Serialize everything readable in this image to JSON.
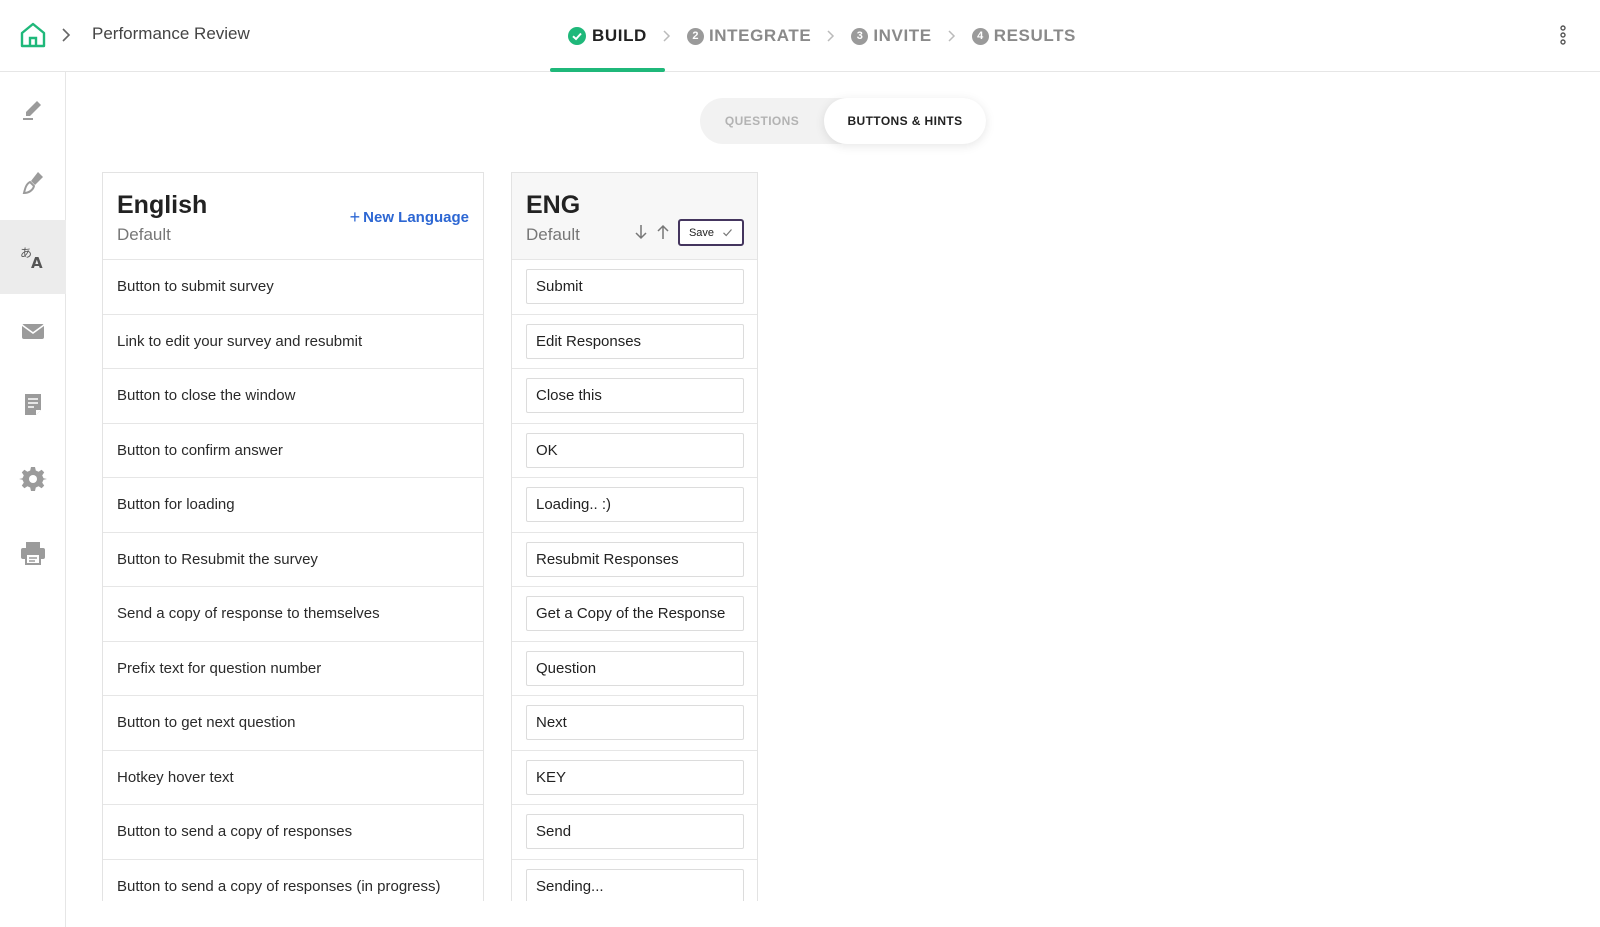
{
  "header": {
    "title": "Performance Review",
    "steps": [
      {
        "label": "BUILD",
        "num": "",
        "state": "complete"
      },
      {
        "label": "INTEGRATE",
        "num": "2",
        "state": "pending"
      },
      {
        "label": "INVITE",
        "num": "3",
        "state": "pending"
      },
      {
        "label": "RESULTS",
        "num": "4",
        "state": "pending"
      }
    ],
    "accent_color": "#1fb87a"
  },
  "sidebar": {
    "items": [
      {
        "icon": "pen-icon",
        "active": false
      },
      {
        "icon": "paint-brush-icon",
        "active": false
      },
      {
        "icon": "translate-icon",
        "active": true
      },
      {
        "icon": "mail-icon",
        "active": false
      },
      {
        "icon": "document-icon",
        "active": false
      },
      {
        "icon": "gear-icon",
        "active": false
      },
      {
        "icon": "printer-icon",
        "active": false
      }
    ]
  },
  "toggle": {
    "questions": "QUESTIONS",
    "buttons_hints": "BUTTONS & HINTS",
    "selected": "BUTTONS & HINTS"
  },
  "left_panel": {
    "language": "English",
    "subtitle": "Default",
    "new_language": "New Language",
    "rows": [
      "Button to submit survey",
      "Link to edit your survey and resubmit",
      "Button to close the window",
      "Button to confirm answer",
      "Button for loading",
      "Button to Resubmit the survey",
      "Send a copy of response to themselves",
      "Prefix text for question number",
      "Button to get next question",
      "Hotkey hover text",
      "Button to send a copy of responses",
      "Button to send a copy of responses (in progress)"
    ]
  },
  "right_panel": {
    "language": "ENG",
    "subtitle": "Default",
    "save_label": "Save",
    "values": [
      "Submit",
      "Edit Responses",
      "Close this",
      "OK",
      "Loading.. :)",
      "Resubmit Responses",
      "Get a Copy of the Response",
      "Question",
      "Next",
      "KEY",
      "Send",
      "Sending..."
    ]
  }
}
